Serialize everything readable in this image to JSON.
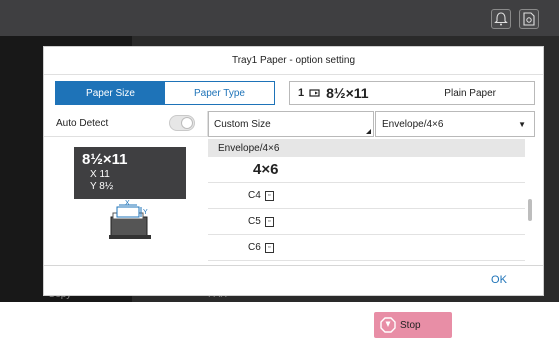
{
  "background": {
    "left_label": "Copy",
    "bottom_label": "FAX"
  },
  "topbar": {
    "icons": [
      "bell-icon",
      "manual-icon"
    ]
  },
  "dialog": {
    "title": "Tray1 Paper - option setting",
    "tabs": [
      {
        "label": "Paper Size",
        "active": true
      },
      {
        "label": "Paper Type",
        "active": false
      }
    ],
    "paper_info": {
      "tray": "1",
      "size": "8½×11",
      "type": "Plain Paper"
    },
    "auto_detect": {
      "label": "Auto Detect",
      "enabled": false
    },
    "size_display": {
      "main": "8½×11",
      "x_line": "X 11",
      "y_line": "Y 8½"
    },
    "custom_size": {
      "label": "Custom Size"
    },
    "envelope_dropdown": {
      "value": "Envelope/4×6"
    },
    "list": {
      "header": "Envelope/4×6",
      "items": [
        {
          "label": "4×6"
        },
        {
          "label": "C4"
        },
        {
          "label": "C5"
        },
        {
          "label": "C6"
        }
      ]
    },
    "ok_label": "OK"
  },
  "stop_button": {
    "label": "Stop"
  },
  "colors": {
    "accent": "#1e73b8",
    "stop": "#e88ea6",
    "dark": "#3f3f41"
  }
}
